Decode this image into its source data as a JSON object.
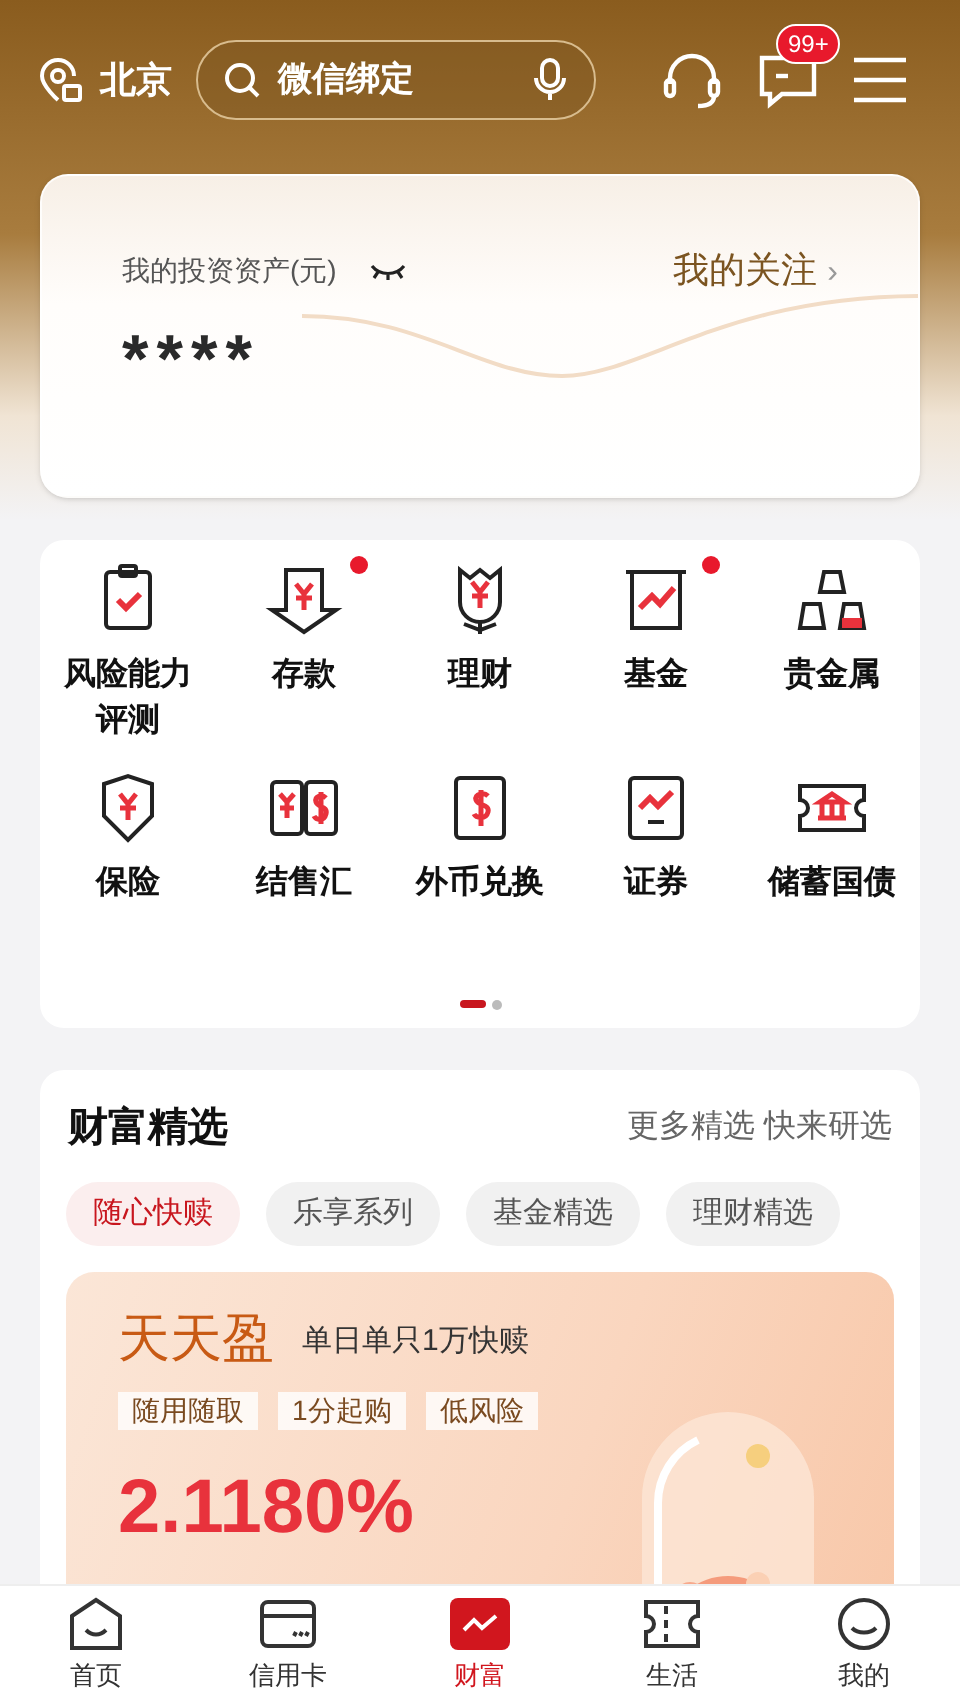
{
  "header": {
    "city": "北京",
    "search": {
      "value": "微信绑定"
    },
    "message_badge": "99+"
  },
  "assets": {
    "label": "我的投资资产(元)",
    "link": "我的关注",
    "link_arrow": "›",
    "amount": "****"
  },
  "services": [
    {
      "label": "风险能力评测",
      "dot": false
    },
    {
      "label": "存款",
      "dot": true
    },
    {
      "label": "理财",
      "dot": false
    },
    {
      "label": "基金",
      "dot": true
    },
    {
      "label": "贵金属",
      "dot": false
    },
    {
      "label": "保险",
      "dot": false
    },
    {
      "label": "结售汇",
      "dot": false
    },
    {
      "label": "外币兑换",
      "dot": false
    },
    {
      "label": "证券",
      "dot": false
    },
    {
      "label": "储蓄国债",
      "dot": false
    }
  ],
  "pager": [
    {
      "selected": true
    },
    {
      "selected": false
    }
  ],
  "wealth": {
    "title": "财富精选",
    "more": "更多精选 快来研选",
    "chips": [
      {
        "label": "随心快赎",
        "selected": true
      },
      {
        "label": "乐享系列",
        "selected": false
      },
      {
        "label": "基金精选",
        "selected": false
      },
      {
        "label": "理财精选",
        "selected": false
      }
    ],
    "product": {
      "name": "天天盈",
      "subtitle": "单日单只1万快赎",
      "tags": [
        "随用随取",
        "1分起购",
        "低风险"
      ],
      "rate": "2.1180%",
      "kind": "picture"
    }
  },
  "tabbar": [
    {
      "label": "首页",
      "selected": false
    },
    {
      "label": "信用卡",
      "selected": false
    },
    {
      "label": "财富",
      "selected": true
    },
    {
      "label": "生活",
      "selected": false
    },
    {
      "label": "我的",
      "selected": false
    }
  ]
}
